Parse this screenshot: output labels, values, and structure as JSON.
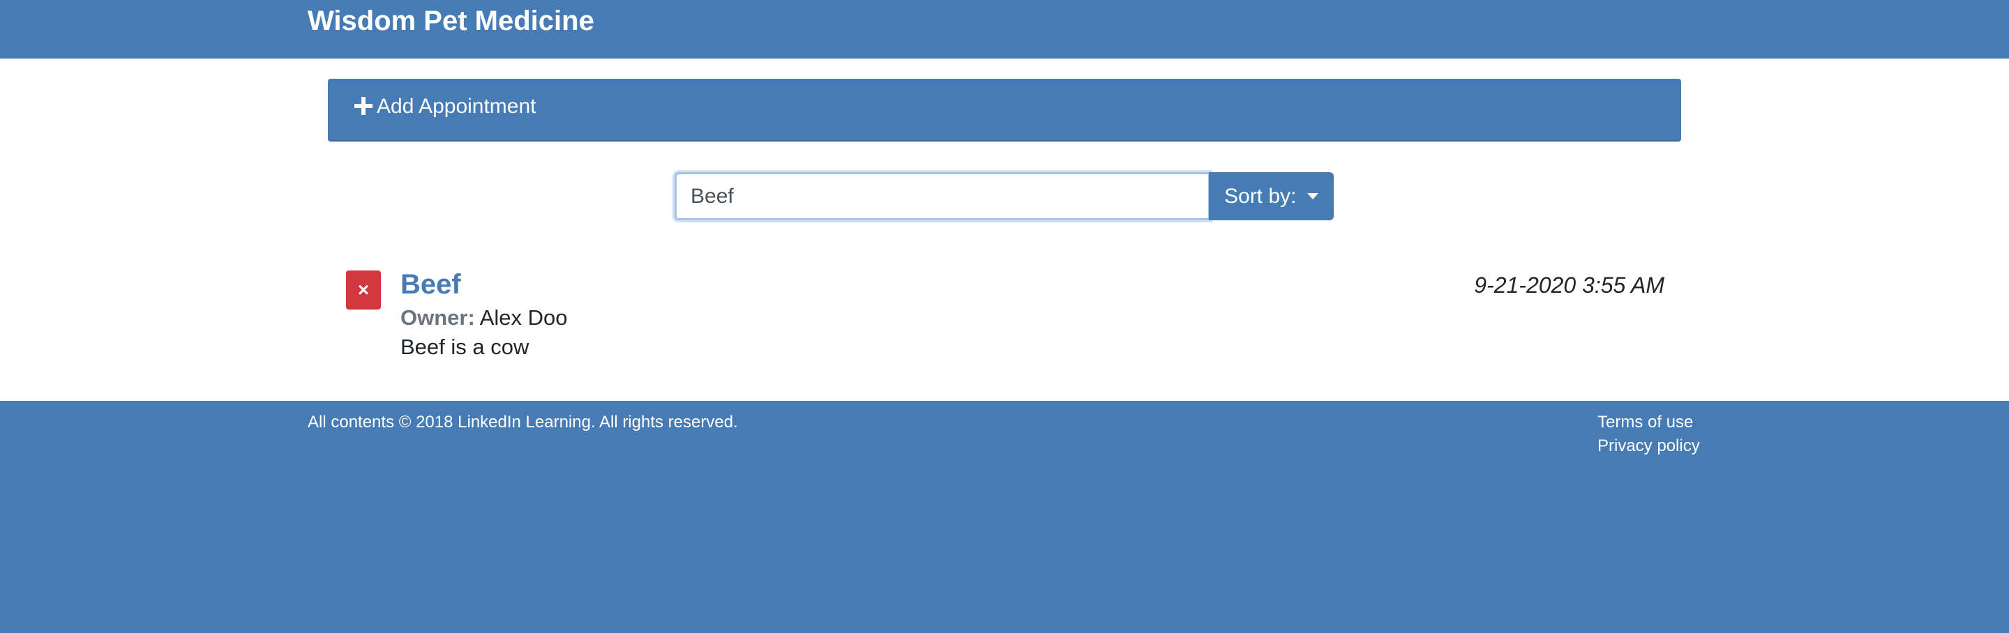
{
  "header": {
    "brand": "Wisdom Pet Medicine"
  },
  "add_panel": {
    "label": "Add Appointment",
    "icon": "plus-icon"
  },
  "search": {
    "value": "Beef",
    "sort_label": "Sort by:"
  },
  "appointments": [
    {
      "pet_name": "Beef",
      "owner_label": "Owner:",
      "owner_name": "Alex Doo",
      "notes": "Beef is a cow",
      "date": "9-21-2020 3:55 AM",
      "delete_symbol": "×"
    }
  ],
  "footer": {
    "copyright": "All contents © 2018 LinkedIn Learning. All rights reserved.",
    "links": [
      "Terms of use",
      "Privacy policy"
    ]
  },
  "colors": {
    "brand": "#467bb5",
    "delete": "#d0373f",
    "muted": "#6c757d"
  }
}
